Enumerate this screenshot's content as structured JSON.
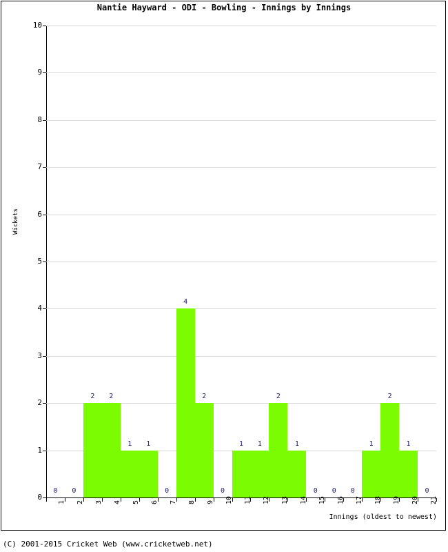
{
  "chart_data": {
    "type": "bar",
    "title": "Nantie Hayward - ODI - Bowling - Innings by Innings",
    "xlabel": "Innings (oldest to newest)",
    "ylabel": "Wickets",
    "categories": [
      "1",
      "2",
      "3",
      "4",
      "5",
      "6",
      "7",
      "8",
      "9",
      "10",
      "11",
      "12",
      "13",
      "14",
      "15",
      "16",
      "17",
      "18",
      "19",
      "20",
      "21"
    ],
    "values": [
      0,
      0,
      2,
      2,
      1,
      1,
      0,
      4,
      2,
      0,
      1,
      1,
      2,
      1,
      0,
      0,
      0,
      1,
      2,
      1,
      0
    ],
    "data_labels": [
      "0",
      "0",
      "2",
      "2",
      "1",
      "1",
      "0",
      "4",
      "2",
      "0",
      "1",
      "1",
      "2",
      "1",
      "0",
      "0",
      "0",
      "1",
      "2",
      "1",
      "0"
    ],
    "ylim": [
      0,
      10
    ],
    "yticks": [
      0,
      1,
      2,
      3,
      4,
      5,
      6,
      7,
      8,
      9,
      10
    ],
    "ytick_labels": [
      "0",
      "1",
      "2",
      "3",
      "4",
      "5",
      "6",
      "7",
      "8",
      "9",
      "10"
    ],
    "grid": true,
    "legend": false,
    "bar_color": "#7cfc00",
    "label_color": "#191970",
    "grid_color": "#d8d8d8",
    "axis_color": "#000000"
  },
  "footer": {
    "copyright": "(C) 2001-2015 Cricket Web (www.cricketweb.net)"
  }
}
